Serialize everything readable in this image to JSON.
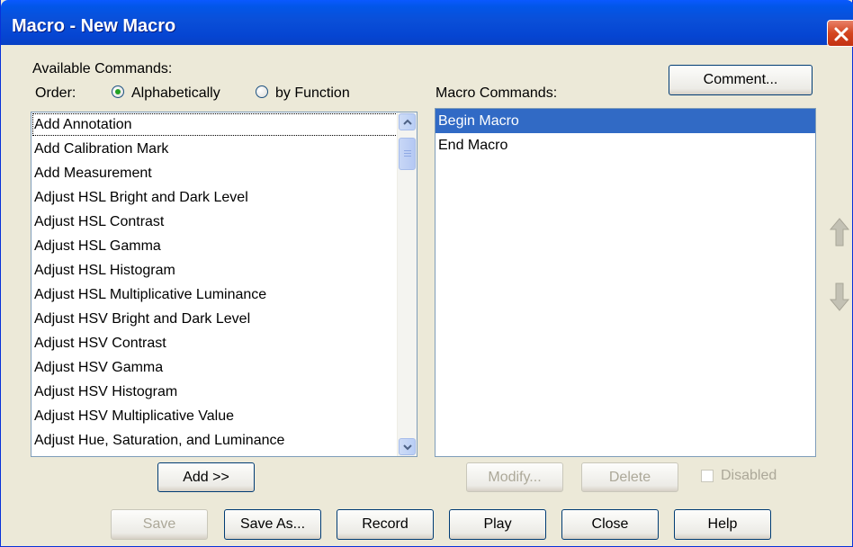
{
  "window": {
    "title": "Macro - New Macro"
  },
  "available": {
    "heading": "Available Commands:",
    "order_label": "Order:",
    "order_options": [
      "Alphabetically",
      "by Function"
    ],
    "order_selected": "Alphabetically",
    "items": [
      "Add Annotation",
      "Add Calibration Mark",
      "Add Measurement",
      "Adjust HSL Bright and Dark Level",
      "Adjust HSL Contrast",
      "Adjust HSL Gamma",
      "Adjust HSL Histogram",
      "Adjust HSL Multiplicative Luminance",
      "Adjust HSV Bright and Dark Level",
      "Adjust HSV Contrast",
      "Adjust HSV Gamma",
      "Adjust HSV Histogram",
      "Adjust HSV Multiplicative Value",
      "Adjust Hue, Saturation, and Luminance"
    ],
    "add_button": "Add >>"
  },
  "macro": {
    "heading": "Macro Commands:",
    "comment_button": "Comment...",
    "items": [
      "Begin Macro",
      "End Macro"
    ],
    "selected_item": "Begin Macro",
    "modify_button": "Modify...",
    "delete_button": "Delete",
    "disabled_label": "Disabled"
  },
  "footer": {
    "save": "Save",
    "save_as": "Save As...",
    "record": "Record",
    "play": "Play",
    "close": "Close",
    "help": "Help"
  },
  "icons": {
    "close": "close-icon",
    "scroll_up": "scroll-up-icon",
    "scroll_down": "scroll-down-icon",
    "move_up": "move-up-arrow-icon",
    "move_down": "move-down-arrow-icon"
  },
  "colors": {
    "titlebar": "#0a4fd8",
    "selection": "#316ac5",
    "dialog_bg": "#ece9d8"
  }
}
